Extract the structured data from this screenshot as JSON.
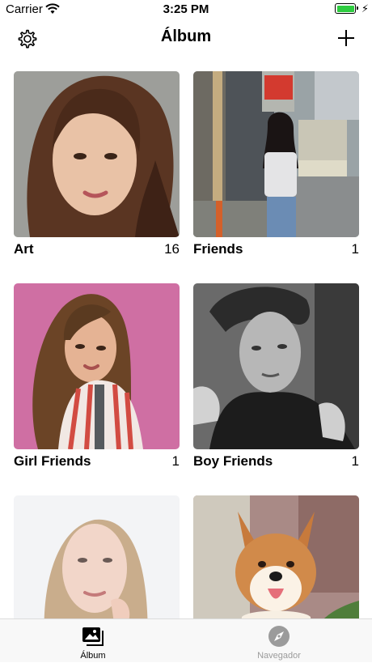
{
  "status_bar": {
    "carrier": "Carrier",
    "time": "3:25 PM"
  },
  "nav": {
    "title": "Álbum",
    "settings_icon": "gear-icon",
    "add_icon": "plus-icon"
  },
  "albums": [
    {
      "name": "Art",
      "count": "16"
    },
    {
      "name": "Friends",
      "count": "1"
    },
    {
      "name": "Girl Friends",
      "count": "1"
    },
    {
      "name": "Boy Friends",
      "count": "1"
    },
    {
      "name": "",
      "count": ""
    },
    {
      "name": "",
      "count": ""
    }
  ],
  "tab_bar": {
    "items": [
      {
        "label": "Álbum",
        "icon": "photo-stack-icon",
        "selected": true
      },
      {
        "label": "Navegador",
        "icon": "compass-icon",
        "selected": false
      }
    ]
  },
  "colors": {
    "battery": "#2ecc40",
    "tab_active": "#000000",
    "tab_inactive": "#9b9b9b",
    "tab_bar_bg": "#f8f8f8"
  }
}
